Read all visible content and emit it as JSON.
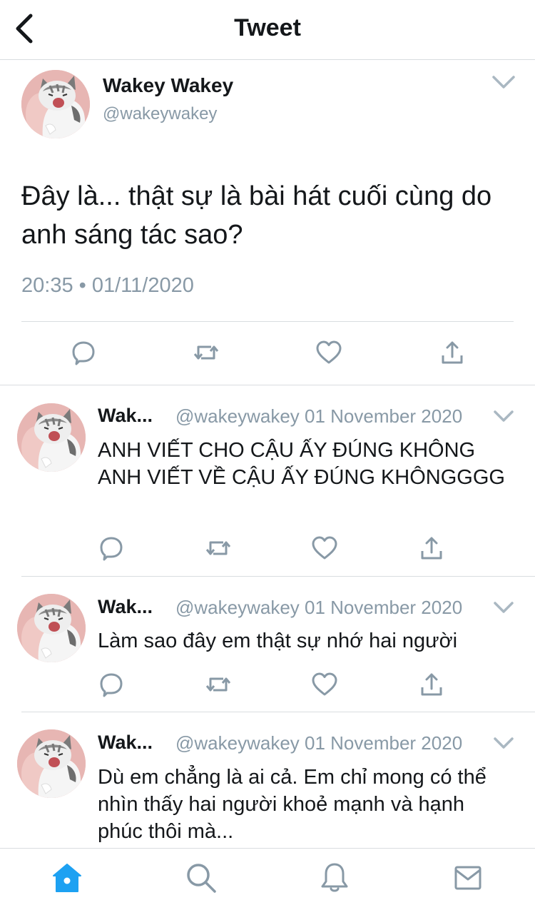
{
  "header": {
    "title": "Tweet"
  },
  "main_tweet": {
    "name": "Wakey Wakey",
    "handle": "@wakeywakey",
    "text": "Đây là... thật sự là bài hát cuối cùng do anh sáng tác sao?",
    "timestamp": "20:35 • 01/11/2020"
  },
  "replies": [
    {
      "name": "Wak...",
      "meta": "@wakeywakey 01 November 2020",
      "text": "ANH VIẾT CHO CẬU ẤY ĐÚNG KHÔNG ANH VIẾT VỀ CẬU ẤY ĐÚNG KHÔNGGGG"
    },
    {
      "name": "Wak...",
      "meta": "@wakeywakey 01 November 2020",
      "text": "Làm sao đây em thật sự nhớ hai người"
    },
    {
      "name": "Wak...",
      "meta": "@wakeywakey 01 November 2020",
      "text": "Dù em chẳng là ai cả. Em chỉ mong có thể nhìn thấy hai người khoẻ mạnh và hạnh phúc thôi mà..."
    }
  ],
  "icons": {
    "back": "chevron-left-icon",
    "menu": "chevron-down-icon",
    "actions": [
      "reply-icon",
      "retweet-icon",
      "like-icon",
      "share-icon"
    ],
    "tabs": [
      "home-icon",
      "search-icon",
      "notifications-icon",
      "messages-icon"
    ]
  },
  "colors": {
    "accent": "#1da1f2",
    "icon": "#8899a6",
    "text": "#14171a",
    "divider": "#d9dde0"
  }
}
